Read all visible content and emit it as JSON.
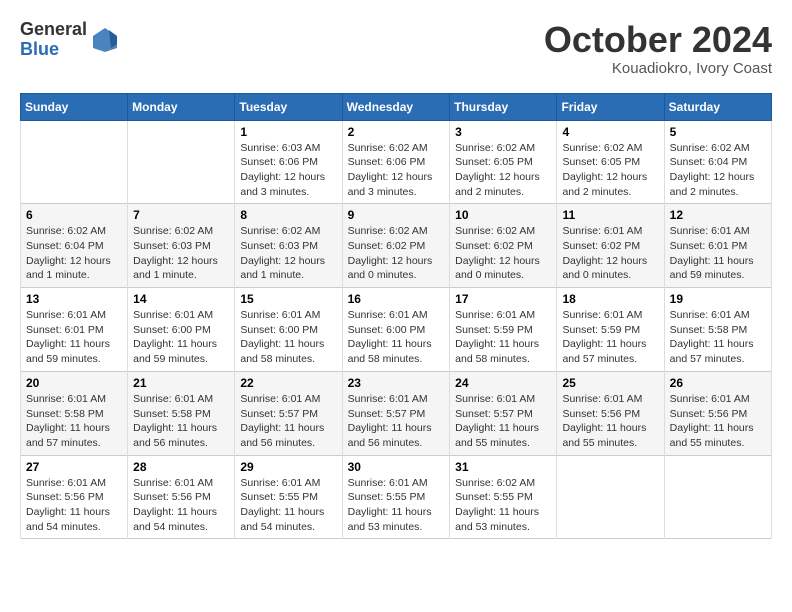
{
  "logo": {
    "general": "General",
    "blue": "Blue"
  },
  "title": "October 2024",
  "location": "Kouadiokro, Ivory Coast",
  "headers": [
    "Sunday",
    "Monday",
    "Tuesday",
    "Wednesday",
    "Thursday",
    "Friday",
    "Saturday"
  ],
  "weeks": [
    [
      {
        "day": "",
        "info": ""
      },
      {
        "day": "",
        "info": ""
      },
      {
        "day": "1",
        "info": "Sunrise: 6:03 AM\nSunset: 6:06 PM\nDaylight: 12 hours\nand 3 minutes."
      },
      {
        "day": "2",
        "info": "Sunrise: 6:02 AM\nSunset: 6:06 PM\nDaylight: 12 hours\nand 3 minutes."
      },
      {
        "day": "3",
        "info": "Sunrise: 6:02 AM\nSunset: 6:05 PM\nDaylight: 12 hours\nand 2 minutes."
      },
      {
        "day": "4",
        "info": "Sunrise: 6:02 AM\nSunset: 6:05 PM\nDaylight: 12 hours\nand 2 minutes."
      },
      {
        "day": "5",
        "info": "Sunrise: 6:02 AM\nSunset: 6:04 PM\nDaylight: 12 hours\nand 2 minutes."
      }
    ],
    [
      {
        "day": "6",
        "info": "Sunrise: 6:02 AM\nSunset: 6:04 PM\nDaylight: 12 hours\nand 1 minute."
      },
      {
        "day": "7",
        "info": "Sunrise: 6:02 AM\nSunset: 6:03 PM\nDaylight: 12 hours\nand 1 minute."
      },
      {
        "day": "8",
        "info": "Sunrise: 6:02 AM\nSunset: 6:03 PM\nDaylight: 12 hours\nand 1 minute."
      },
      {
        "day": "9",
        "info": "Sunrise: 6:02 AM\nSunset: 6:02 PM\nDaylight: 12 hours\nand 0 minutes."
      },
      {
        "day": "10",
        "info": "Sunrise: 6:02 AM\nSunset: 6:02 PM\nDaylight: 12 hours\nand 0 minutes."
      },
      {
        "day": "11",
        "info": "Sunrise: 6:01 AM\nSunset: 6:02 PM\nDaylight: 12 hours\nand 0 minutes."
      },
      {
        "day": "12",
        "info": "Sunrise: 6:01 AM\nSunset: 6:01 PM\nDaylight: 11 hours\nand 59 minutes."
      }
    ],
    [
      {
        "day": "13",
        "info": "Sunrise: 6:01 AM\nSunset: 6:01 PM\nDaylight: 11 hours\nand 59 minutes."
      },
      {
        "day": "14",
        "info": "Sunrise: 6:01 AM\nSunset: 6:00 PM\nDaylight: 11 hours\nand 59 minutes."
      },
      {
        "day": "15",
        "info": "Sunrise: 6:01 AM\nSunset: 6:00 PM\nDaylight: 11 hours\nand 58 minutes."
      },
      {
        "day": "16",
        "info": "Sunrise: 6:01 AM\nSunset: 6:00 PM\nDaylight: 11 hours\nand 58 minutes."
      },
      {
        "day": "17",
        "info": "Sunrise: 6:01 AM\nSunset: 5:59 PM\nDaylight: 11 hours\nand 58 minutes."
      },
      {
        "day": "18",
        "info": "Sunrise: 6:01 AM\nSunset: 5:59 PM\nDaylight: 11 hours\nand 57 minutes."
      },
      {
        "day": "19",
        "info": "Sunrise: 6:01 AM\nSunset: 5:58 PM\nDaylight: 11 hours\nand 57 minutes."
      }
    ],
    [
      {
        "day": "20",
        "info": "Sunrise: 6:01 AM\nSunset: 5:58 PM\nDaylight: 11 hours\nand 57 minutes."
      },
      {
        "day": "21",
        "info": "Sunrise: 6:01 AM\nSunset: 5:58 PM\nDaylight: 11 hours\nand 56 minutes."
      },
      {
        "day": "22",
        "info": "Sunrise: 6:01 AM\nSunset: 5:57 PM\nDaylight: 11 hours\nand 56 minutes."
      },
      {
        "day": "23",
        "info": "Sunrise: 6:01 AM\nSunset: 5:57 PM\nDaylight: 11 hours\nand 56 minutes."
      },
      {
        "day": "24",
        "info": "Sunrise: 6:01 AM\nSunset: 5:57 PM\nDaylight: 11 hours\nand 55 minutes."
      },
      {
        "day": "25",
        "info": "Sunrise: 6:01 AM\nSunset: 5:56 PM\nDaylight: 11 hours\nand 55 minutes."
      },
      {
        "day": "26",
        "info": "Sunrise: 6:01 AM\nSunset: 5:56 PM\nDaylight: 11 hours\nand 55 minutes."
      }
    ],
    [
      {
        "day": "27",
        "info": "Sunrise: 6:01 AM\nSunset: 5:56 PM\nDaylight: 11 hours\nand 54 minutes."
      },
      {
        "day": "28",
        "info": "Sunrise: 6:01 AM\nSunset: 5:56 PM\nDaylight: 11 hours\nand 54 minutes."
      },
      {
        "day": "29",
        "info": "Sunrise: 6:01 AM\nSunset: 5:55 PM\nDaylight: 11 hours\nand 54 minutes."
      },
      {
        "day": "30",
        "info": "Sunrise: 6:01 AM\nSunset: 5:55 PM\nDaylight: 11 hours\nand 53 minutes."
      },
      {
        "day": "31",
        "info": "Sunrise: 6:02 AM\nSunset: 5:55 PM\nDaylight: 11 hours\nand 53 minutes."
      },
      {
        "day": "",
        "info": ""
      },
      {
        "day": "",
        "info": ""
      }
    ]
  ]
}
